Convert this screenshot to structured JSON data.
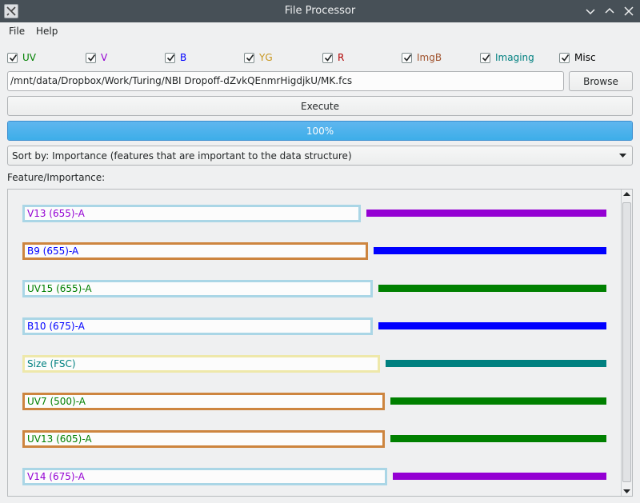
{
  "window": {
    "title": "File Processor"
  },
  "menu": {
    "file": "File",
    "help": "Help"
  },
  "checkboxes": [
    {
      "label": "UV",
      "checked": true,
      "color": "#008000"
    },
    {
      "label": "V",
      "checked": true,
      "color": "#9400d3"
    },
    {
      "label": "B",
      "checked": true,
      "color": "#0000ff"
    },
    {
      "label": "YG",
      "checked": true,
      "color": "#c8961e"
    },
    {
      "label": "R",
      "checked": true,
      "color": "#b00000"
    },
    {
      "label": "ImgB",
      "checked": true,
      "color": "#a0522d"
    },
    {
      "label": "Imaging",
      "checked": true,
      "color": "#008080"
    },
    {
      "label": "Misc",
      "checked": true,
      "color": "#000000"
    }
  ],
  "file": {
    "path": "/mnt/data/Dropbox/Work/Turing/NBI Dropoff-dZvkQEnmrHigdjkU/MK.fcs",
    "browse_label": "Browse",
    "execute_label": "Execute"
  },
  "progress": {
    "text": "100%",
    "value": 1.0
  },
  "sort": {
    "selected": "Sort by: Importance (features that are important to the data structure)"
  },
  "features_label": "Feature/Importance:",
  "features": [
    {
      "name": "V13 (655)-A",
      "text_color": "#9400d3",
      "border_color": "#aad6e6",
      "bar_color": "#9400d3",
      "importance": 1.0
    },
    {
      "name": "B9 (655)-A",
      "text_color": "#0000ff",
      "border_color": "#cd853f",
      "bar_color": "#0000ff",
      "importance": 0.97
    },
    {
      "name": "UV15 (655)-A",
      "text_color": "#008000",
      "border_color": "#aad6e6",
      "bar_color": "#008000",
      "importance": 0.95
    },
    {
      "name": "B10 (675)-A",
      "text_color": "#0000ff",
      "border_color": "#aad6e6",
      "bar_color": "#0000ff",
      "importance": 0.95
    },
    {
      "name": "Size (FSC)",
      "text_color": "#008080",
      "border_color": "#eee8aa",
      "bar_color": "#008080",
      "importance": 0.92
    },
    {
      "name": "UV7 (500)-A",
      "text_color": "#008000",
      "border_color": "#cd853f",
      "bar_color": "#008000",
      "importance": 0.9
    },
    {
      "name": "UV13 (605)-A",
      "text_color": "#008000",
      "border_color": "#cd853f",
      "bar_color": "#008000",
      "importance": 0.9
    },
    {
      "name": "V14 (675)-A",
      "text_color": "#9400d3",
      "border_color": "#aad6e6",
      "bar_color": "#9400d3",
      "importance": 0.89
    }
  ]
}
